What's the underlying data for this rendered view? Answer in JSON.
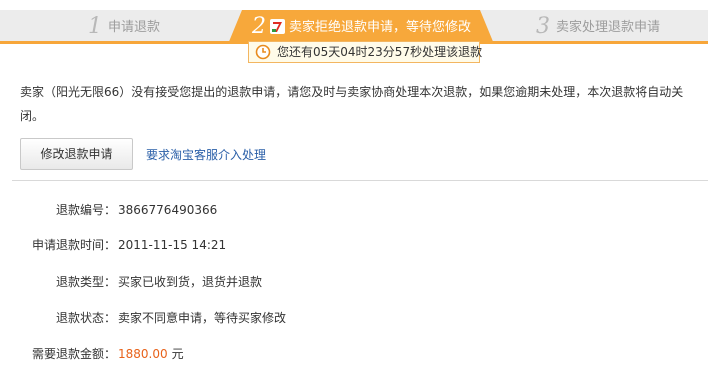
{
  "steps": [
    {
      "num": "1",
      "label": "申请退款"
    },
    {
      "num": "2",
      "label": "卖家拒绝退款申请，等待您修改"
    },
    {
      "num": "3",
      "label": "卖家处理退款申请"
    }
  ],
  "timer": {
    "text": "您还有05天04时23分57秒处理该退款"
  },
  "notice": "卖家（阳光无限66）没有接受您提出的退款申请，请您及时与卖家协商处理本次退款，如果您逾期未处理，本次退款将自动关闭。",
  "actions": {
    "modify_label": "修改退款申请",
    "escalate_label": "要求淘宝客服介入处理"
  },
  "details": [
    {
      "label": "退款编号：",
      "value": "3866776490366"
    },
    {
      "label": "申请退款时间：",
      "value": "2011-11-15 14:21"
    },
    {
      "label": "退款类型：",
      "value": "买家已收到货，退货并退款"
    },
    {
      "label": "退款状态：",
      "value": "卖家不同意申请，等待买家修改"
    }
  ],
  "amount": {
    "label": "需要退款金额：",
    "value": "1880.00",
    "unit": "元"
  },
  "colors": {
    "accent": "#f7a83b",
    "link": "#2a5fa8",
    "amount": "#e8621a"
  }
}
